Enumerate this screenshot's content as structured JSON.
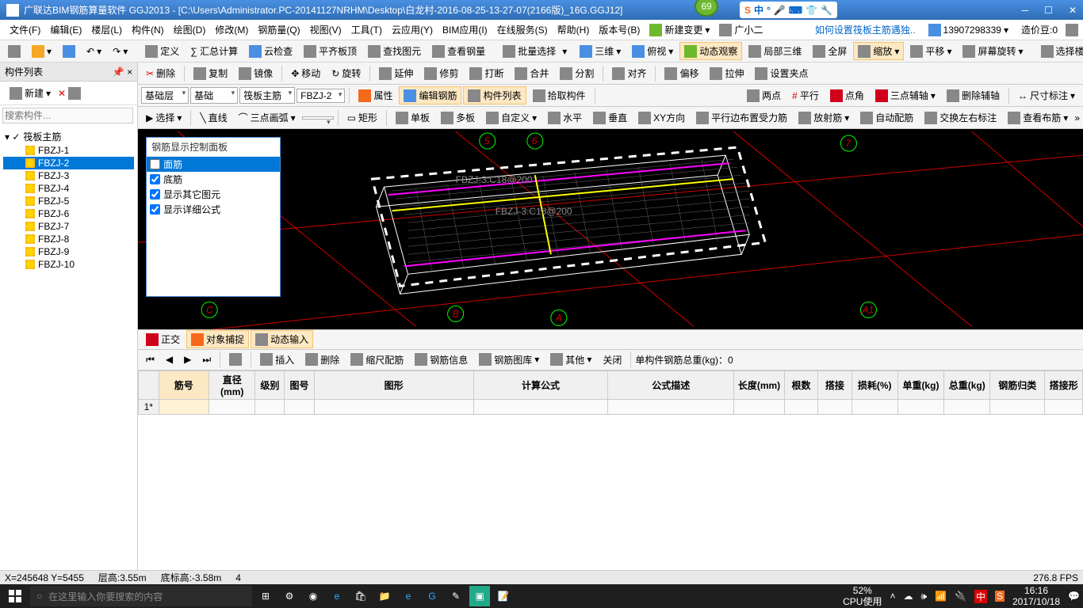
{
  "title": "广联达BIM钢筋算量软件 GGJ2013 - [C:\\Users\\Administrator.PC-20141127NRHM\\Desktop\\白龙村-2016-08-25-13-27-07(2166版)_16G.GGJ12]",
  "green_badge": "69",
  "sogou": "中",
  "win": {
    "min": "─",
    "max": "☐",
    "close": "✕"
  },
  "menus": [
    "文件(F)",
    "编辑(E)",
    "楼层(L)",
    "构件(N)",
    "绘图(D)",
    "修改(M)",
    "钢筋量(Q)",
    "视图(V)",
    "工具(T)",
    "云应用(Y)",
    "BIM应用(I)",
    "在线服务(S)",
    "帮助(H)",
    "版本号(B)"
  ],
  "menu_right": {
    "new_change": "新建变更",
    "user": "广小二",
    "help_link": "如何设置筏板主筋遇独..",
    "phone": "13907298339",
    "credit": "造价豆:0"
  },
  "tb1": {
    "define": "定义",
    "sum": "∑ 汇总计算",
    "cloud": "云检查",
    "flat": "平齐板顶",
    "find": "查找图元",
    "steel": "查看钢量",
    "batch": "批量选择",
    "threed": "三维",
    "down": "俯视",
    "dyn": "动态观察",
    "local": "局部三维",
    "full": "全屏",
    "zoom": "缩放",
    "pan": "平移",
    "rotate": "屏幕旋转",
    "floor": "选择楼层"
  },
  "tb2": {
    "del": "删除",
    "copy": "复制",
    "mirror": "镜像",
    "move": "移动",
    "rot": "旋转",
    "ext": "延伸",
    "trim": "修剪",
    "break": "打断",
    "merge": "合并",
    "split": "分割",
    "align": "对齐",
    "offset": "偏移",
    "stretch": "拉伸",
    "pt": "设置夹点"
  },
  "tb3": {
    "combo1": "基础层",
    "combo2": "基础",
    "combo3": "筏板主筋",
    "combo4": "FBZJ-2",
    "attr": "属性",
    "edit": "编辑钢筋",
    "list": "构件列表",
    "pick": "拾取构件",
    "twopt": "两点",
    "para": "平行",
    "ptang": "点角",
    "threept": "三点辅轴",
    "delaux": "删除辅轴",
    "dim": "尺寸标注"
  },
  "tb4": {
    "select": "选择",
    "line": "直线",
    "arc": "三点画弧",
    "rect": "矩形",
    "single": "单板",
    "multi": "多板",
    "custom": "自定义",
    "horiz": "水平",
    "vert": "垂直",
    "xy": "XY方向",
    "paraforce": "平行边布置受力筋",
    "radial": "放射筋",
    "auto": "自动配筋",
    "swap": "交换左右标注",
    "view": "查看布筋"
  },
  "left": {
    "title": "构件列表",
    "new": "新建",
    "search": "搜索构件...",
    "root": "筏板主筋",
    "items": [
      "FBZJ-1",
      "FBZJ-2",
      "FBZJ-3",
      "FBZJ-4",
      "FBZJ-5",
      "FBZJ-6",
      "FBZJ-7",
      "FBZJ-8",
      "FBZJ-9",
      "FBZJ-10"
    ],
    "selected": "FBZJ-2"
  },
  "float": {
    "title": "钢筋显示控制面板",
    "opts": [
      "面筋",
      "底筋",
      "显示其它图元",
      "显示详细公式"
    ]
  },
  "viewlabels": {
    "a": "A",
    "b": "B",
    "c": "C",
    "a1": "A1",
    "n5": "5",
    "n6": "6",
    "n7": "7",
    "fb1": "FBZJ-3:C18@200",
    "fb2": "FBZJ-3:C18@200"
  },
  "btabs": {
    "ortho": "正交",
    "snap": "对象捕捉",
    "dynin": "动态输入"
  },
  "nav": {
    "insert": "插入",
    "del": "删除",
    "scale": "缩尺配筋",
    "info": "钢筋信息",
    "lib": "钢筋图库",
    "other": "其他",
    "close": "关闭",
    "weight": "单构件钢筋总重(kg)：0"
  },
  "cols": [
    "筋号",
    "直径(mm)",
    "级别",
    "图号",
    "图形",
    "计算公式",
    "公式描述",
    "长度(mm)",
    "根数",
    "搭接",
    "损耗(%)",
    "单重(kg)",
    "总重(kg)",
    "钢筋归类",
    "搭接形"
  ],
  "row1": "1*",
  "status": {
    "xy": "X=245648 Y=5455",
    "floor": "层高:3.55m",
    "bottom": "底标高:-3.58m",
    "num": "4",
    "fps": "276.8 FPS"
  },
  "task": {
    "search": "在这里输入你要搜索的内容",
    "cpu": "52%",
    "cpulabel": "CPU使用",
    "time": "16:16",
    "date": "2017/10/18"
  }
}
